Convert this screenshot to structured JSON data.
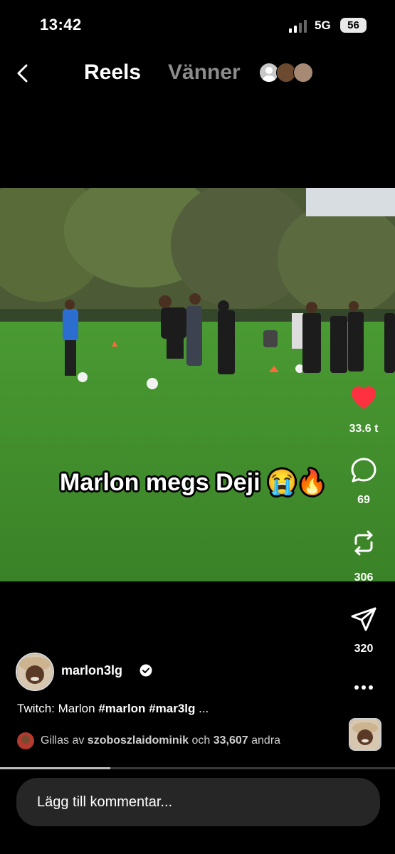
{
  "status_bar": {
    "time": "13:42",
    "network": "5G",
    "battery": "56"
  },
  "header": {
    "reels_tab": "Reels",
    "friends_tab": "Vänner"
  },
  "video": {
    "overlay_caption": "Marlon megs Deji 😭🔥"
  },
  "actions": {
    "likes": "33.6 t",
    "comments": "69",
    "reposts": "306",
    "shares": "320"
  },
  "post": {
    "username": "marlon3lg",
    "caption_prefix": "Twitch: Marlon ",
    "hashtag1": "#marlon",
    "hashtag2": "#mar3lg",
    "caption_suffix": " ...",
    "liked_prefix": "Gillas av ",
    "liked_user": "szoboszlaidominik",
    "liked_mid": " och ",
    "liked_count": "33,607",
    "liked_suffix": " andra"
  },
  "progress": 0.28,
  "comment": {
    "placeholder": "Lägg till kommentar..."
  },
  "colors": {
    "like": "#ff3040",
    "grass": "#3f8a2a",
    "background": "#000000"
  },
  "icons": [
    "back-chevron-icon",
    "heart-icon",
    "comment-icon",
    "repost-icon",
    "share-icon",
    "more-icon",
    "verified-icon"
  ]
}
